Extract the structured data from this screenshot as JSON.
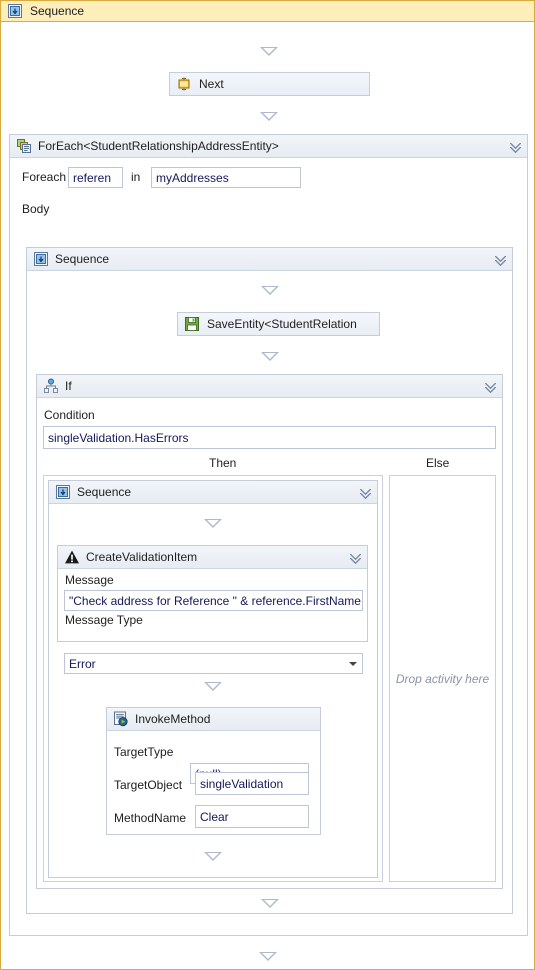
{
  "root": {
    "title": "Sequence",
    "icon": "sequence-icon"
  },
  "activities": {
    "next": {
      "title": "Next",
      "icon": "next-activity-icon"
    },
    "foreach": {
      "title": "ForEach<StudentRelationshipAddressEntity>",
      "icon": "foreach-icon",
      "foreach_label": "Foreach",
      "iterator_value": "referen",
      "in_label": "in",
      "collection_value": "myAddresses",
      "body_label": "Body",
      "collapse_icon": "chevron-up-double-icon"
    },
    "inner_sequence": {
      "title": "Sequence",
      "icon": "sequence-icon",
      "collapse_icon": "chevron-up-double-icon"
    },
    "save_entity": {
      "title": "SaveEntity<StudentRelation",
      "icon": "save-icon"
    },
    "if": {
      "title": "If",
      "icon": "if-icon",
      "collapse_icon": "chevron-up-double-icon",
      "condition_label": "Condition",
      "condition_value": "singleValidation.HasErrors",
      "then_label": "Then",
      "else_label": "Else",
      "else_placeholder": "Drop activity here"
    },
    "then_sequence": {
      "title": "Sequence",
      "icon": "sequence-icon",
      "collapse_icon": "chevron-up-double-icon"
    },
    "create_validation_item": {
      "title": "CreateValidationItem",
      "icon": "warning-icon",
      "collapse_icon": "chevron-up-double-icon",
      "message_label": "Message",
      "message_value": "\"Check address for Reference \" & reference.FirstName ",
      "message_type_label": "Message Type",
      "message_type_value": "Error"
    },
    "invoke_method": {
      "title": "InvokeMethod",
      "icon": "invoke-method-icon",
      "target_type_label": "TargetType",
      "target_type_value": "(null)",
      "target_object_label": "TargetObject",
      "target_object_value": "singleValidation",
      "method_name_label": "MethodName",
      "method_name_value": "Clear"
    }
  },
  "colors": {
    "root_header_bg": "#fdeeba",
    "root_border": "#d8ab41",
    "activity_border": "#c5cddb",
    "header_gradient_top": "#f2f5f9",
    "arrow": "#aeb9cd",
    "placeholder_text": "#8a93a5"
  }
}
